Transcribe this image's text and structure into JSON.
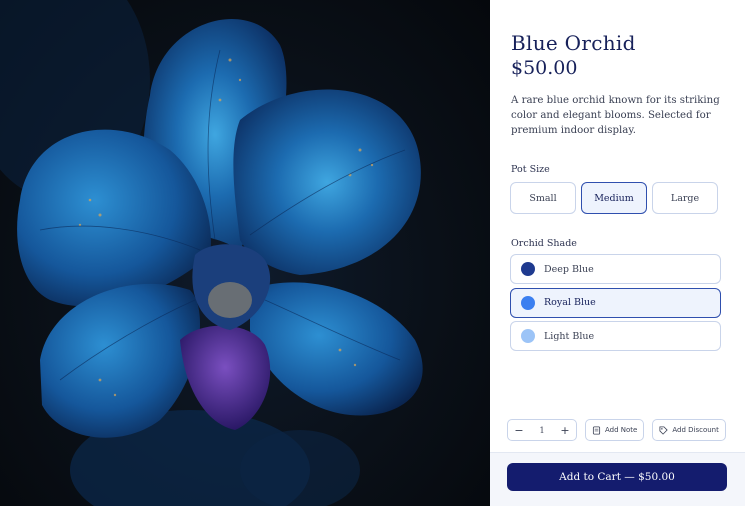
{
  "product": {
    "title": "Blue Orchid",
    "price": "$50.00",
    "description": "A rare blue orchid known for its striking color and elegant blooms. Selected for premium indoor display."
  },
  "pot_size": {
    "label": "Pot Size",
    "options": [
      "Small",
      "Medium",
      "Large"
    ],
    "selected": "Medium"
  },
  "shade": {
    "label": "Orchid Shade",
    "options": [
      {
        "name": "Deep Blue",
        "color": "#1f3a8f"
      },
      {
        "name": "Royal Blue",
        "color": "#3b7ff0"
      },
      {
        "name": "Light Blue",
        "color": "#9cc4f7"
      }
    ],
    "selected": "Royal Blue"
  },
  "quantity": {
    "value": "1",
    "minus_symbol": "−",
    "plus_symbol": "+"
  },
  "actions": {
    "add_note": "Add Note",
    "add_discount": "Add Discount",
    "add_to_cart": "Add to Cart — $50.00"
  },
  "icons": {
    "note": "note-icon",
    "tag": "tag-icon"
  },
  "colors": {
    "accent": "#141c6e",
    "selected_border": "#2f4fae",
    "selected_bg": "#eef3fd"
  }
}
